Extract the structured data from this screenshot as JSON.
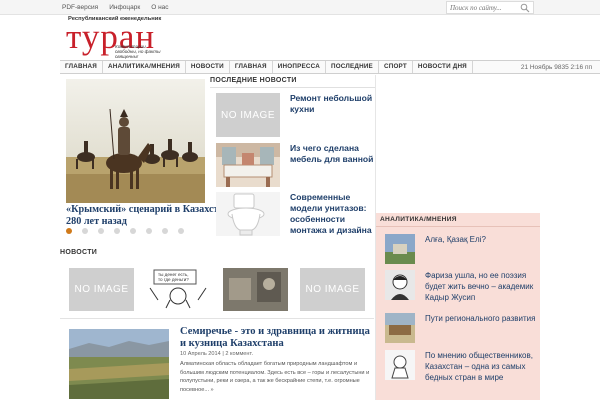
{
  "toplinks": [
    "PDF-версия",
    "Инфоцарк",
    "О нас"
  ],
  "search": {
    "placeholder": "Поиск по сайту..."
  },
  "logo": {
    "tagline": "Республиканский еженедельник",
    "word": "туран",
    "slogan": "Комментарии свободны, но факты священны!"
  },
  "nav": {
    "items": [
      "ГЛАВНАЯ",
      "АНАЛИТИКА/МНЕНИЯ",
      "НОВОСТИ",
      "ГЛАВНАЯ",
      "ИНОПРЕССА",
      "ПОСЛЕДНИЕ",
      "СПОРТ",
      "НОВОСТИ ДНЯ"
    ],
    "datetime": "21 Ноябрь 9835 2:16 пп"
  },
  "slider": {
    "caption": "«Крымский» сценарий в Казахстане: 280 лет назад",
    "dots": 8,
    "active": 0
  },
  "latest": {
    "title": "ПОСЛЕДНИЕ НОВОСТИ",
    "no_image": "NO IMAGE",
    "items": [
      "Ремонт небольшой кухни",
      "Из чего сделана мебель для ванной",
      "Современные модели унитазов: особенности монтажа и дизайна"
    ]
  },
  "analytics": {
    "title": "АНАЛИТИКА/МНЕНИЯ",
    "items": [
      "Алға, Қазақ Елі?",
      "Фариза ушла, но ее поэзия будет жить вечно – академик Кадыр Жусип",
      "Пути регионального развития",
      "По мнению общественников, Казахстан – одна из самых бедных стран в мире"
    ]
  },
  "news": {
    "title": "НОВОСТИ",
    "no_image": "NO IMAGE",
    "cartoon_text": "ты денег есть, то где деньги?"
  },
  "article": {
    "title": "Семиречье - это и здравница и житница и кузница Казахстана",
    "date": "10 Апрель 2014",
    "comments": "2 коммент.",
    "excerpt": "Алматинская область обладает богатым природным ландшафтом и большим людским потенциалом. Здесь есть все – горы и лесалустыни и полупустыни, реки и озера, а так же бескрайние степи, т.е. огромные посевное... »"
  },
  "colors": {
    "logo_red": "#c8202a",
    "link_blue": "#1f3f6a",
    "sidebar_pink": "#f9ded8",
    "dot_active": "#d07a1a"
  }
}
